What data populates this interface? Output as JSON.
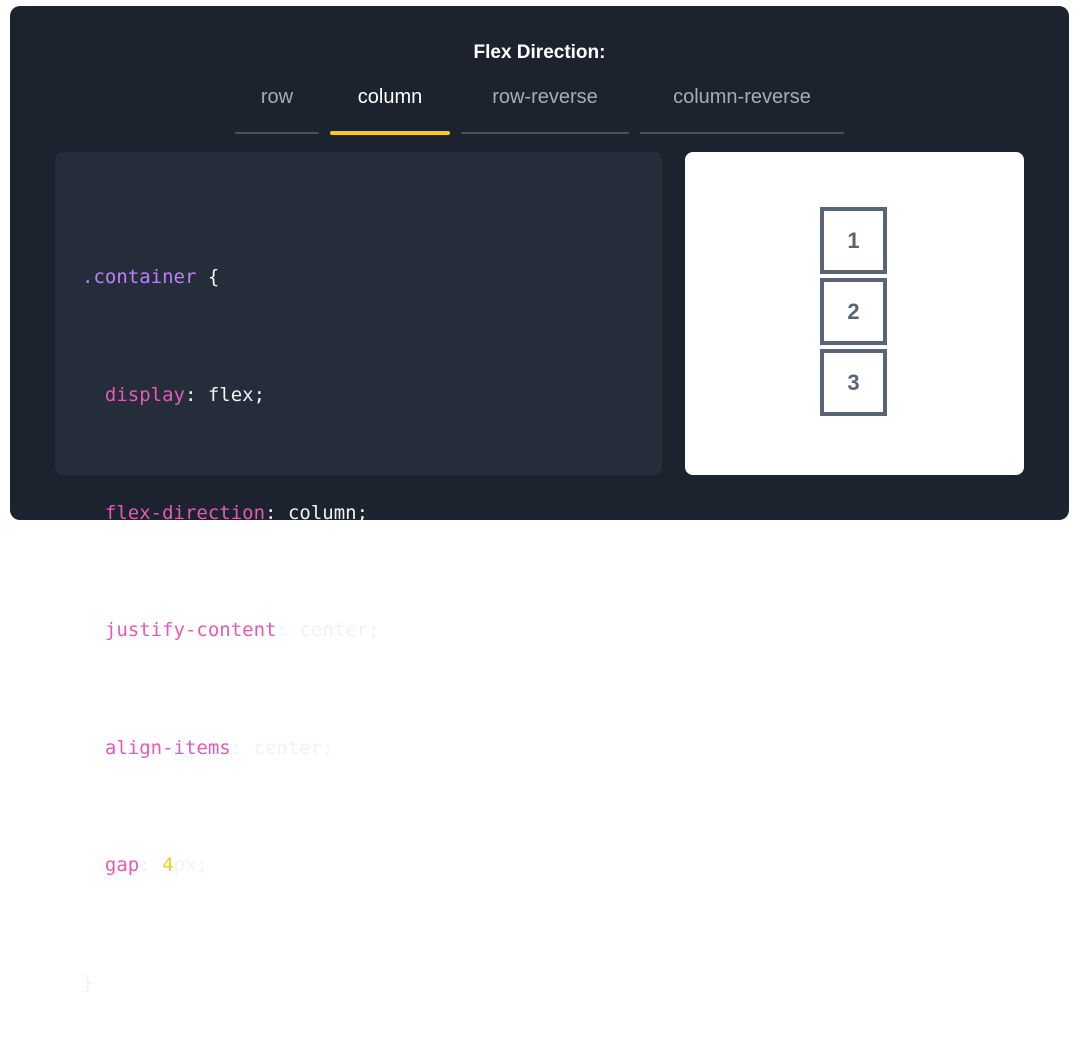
{
  "title": "Flex Direction:",
  "tabs": [
    {
      "label": "row",
      "active": false
    },
    {
      "label": "column",
      "active": true
    },
    {
      "label": "row-reverse",
      "active": false
    },
    {
      "label": "column-reverse",
      "active": false
    }
  ],
  "code": {
    "selector": ".container",
    "open_brace": " {",
    "close_brace": "}",
    "lines": [
      {
        "prop": "display",
        "sep": ": ",
        "value": "flex",
        "end": ";"
      },
      {
        "prop": "flex-direction",
        "sep": ": ",
        "value": "column",
        "end": ";"
      },
      {
        "prop": "justify-content",
        "sep": ": ",
        "value": "center",
        "end": ";"
      },
      {
        "prop": "align-items",
        "sep": ": ",
        "value": "center",
        "end": ";"
      },
      {
        "prop": "gap",
        "sep": ": ",
        "number": "4",
        "unit": "px",
        "end": ";"
      }
    ]
  },
  "preview": {
    "items": [
      "1",
      "2",
      "3"
    ]
  },
  "colors": {
    "background": "#1c232e",
    "code_panel": "#242d39",
    "accent": "#f5cb2b",
    "selector": "#b982f7",
    "property": "#e45bb4",
    "box_border": "#5a6477"
  }
}
